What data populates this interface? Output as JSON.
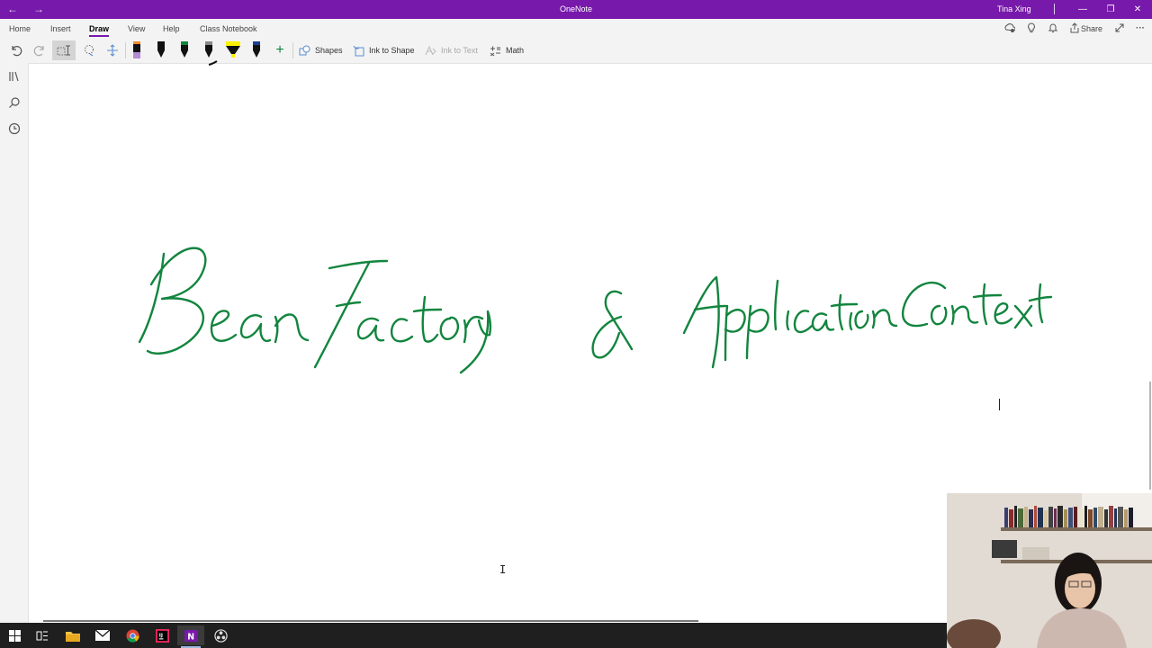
{
  "window": {
    "title": "OneNote",
    "user": "Tina Xing",
    "controls": {
      "minimize": "—",
      "restore": "❐",
      "close": "✕"
    },
    "nav": {
      "back": "←",
      "forward": "→"
    }
  },
  "ribbon": {
    "tabs": [
      {
        "label": "Home",
        "active": false
      },
      {
        "label": "Insert",
        "active": false
      },
      {
        "label": "Draw",
        "active": true
      },
      {
        "label": "View",
        "active": false
      },
      {
        "label": "Help",
        "active": false
      },
      {
        "label": "Class Notebook",
        "active": false
      }
    ],
    "share_label": "Share",
    "more_label": "···",
    "accent": "#7719aa"
  },
  "toolbar": {
    "shapes_label": "Shapes",
    "ink_to_shape_label": "Ink to Shape",
    "ink_to_text_label": "Ink to Text",
    "math_label": "Math",
    "add_pen_label": "+",
    "pens": [
      {
        "name": "pen-purple-highlighter",
        "color": "#b48ad4"
      },
      {
        "name": "pen-black",
        "color": "#111111"
      },
      {
        "name": "pen-green",
        "color": "#12853e"
      },
      {
        "name": "pen-gray",
        "color": "#777777"
      },
      {
        "name": "highlighter-yellow",
        "color": "#fff200"
      },
      {
        "name": "pen-blue",
        "color": "#1c3f94"
      }
    ]
  },
  "canvas": {
    "ink_color": "#12853e",
    "handwritten_text": "BeanFactory & Application Context",
    "cursor_glyph": "I"
  }
}
